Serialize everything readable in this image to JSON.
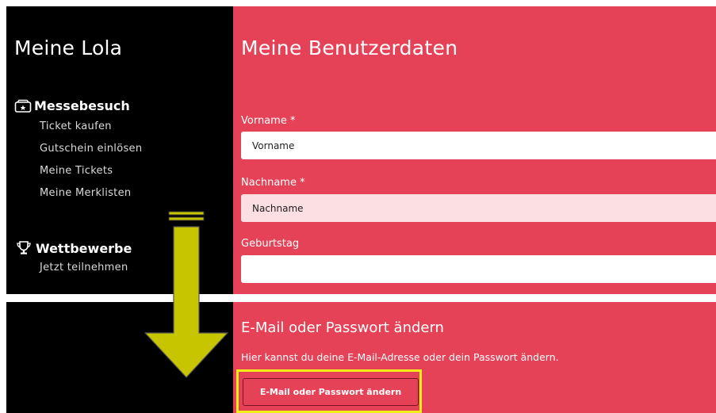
{
  "sidebar": {
    "title": "Meine Lola",
    "sections": [
      {
        "heading": "Messebesuch",
        "icon": "ticket-icon",
        "items": [
          "Ticket kaufen",
          "Gutschein einlösen",
          "Meine Tickets",
          "Meine Merklisten"
        ]
      },
      {
        "heading": "Wettbewerbe",
        "icon": "trophy-icon",
        "items": [
          "Jetzt teilnehmen"
        ]
      }
    ]
  },
  "main": {
    "title": "Meine Benutzerdaten",
    "fields": [
      {
        "label": "Vorname *",
        "placeholder": "Vorname",
        "value": ""
      },
      {
        "label": "Nachname *",
        "placeholder": "Nachname",
        "value": ""
      },
      {
        "label": "Geburtstag",
        "placeholder": "",
        "value": ""
      }
    ]
  },
  "email_section": {
    "title": "E-Mail oder Passwort ändern",
    "description": "Hier kannst du deine E-Mail-Adresse oder dein Passwort ändern.",
    "button_label": "E-Mail oder Passwort ändern"
  },
  "colors": {
    "sidebar_bg": "#000000",
    "content_bg": "#e54258",
    "highlight": "#f0ee16",
    "arrow": "#c7c400"
  }
}
